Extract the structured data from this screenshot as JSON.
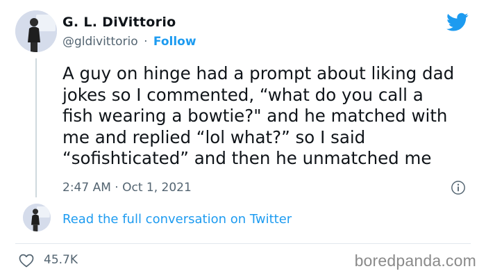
{
  "author": {
    "name": "G. L. DiVittorio",
    "handle": "@gldivittorio",
    "separator": "·",
    "follow_label": "Follow"
  },
  "tweet": {
    "text": "A guy on hinge had a prompt about liking dad\njokes so I commented, “what do you call a\nfish wearing a bowtie?\" and he matched with\nme and replied “lol what?” so I said\n“sofishticated” and then he unmatched me",
    "timestamp": "2:47 AM · Oct 1, 2021"
  },
  "conversation_link": "Read the full conversation on Twitter",
  "likes": {
    "count": "45.7K"
  },
  "watermark": "boredpanda.com",
  "colors": {
    "brand_blue": "#1d9bf0",
    "secondary_text": "#536471",
    "primary_text": "#0f1419"
  },
  "icons": {
    "brand": "twitter-bird-icon",
    "info": "info-icon",
    "like": "heart-icon"
  }
}
